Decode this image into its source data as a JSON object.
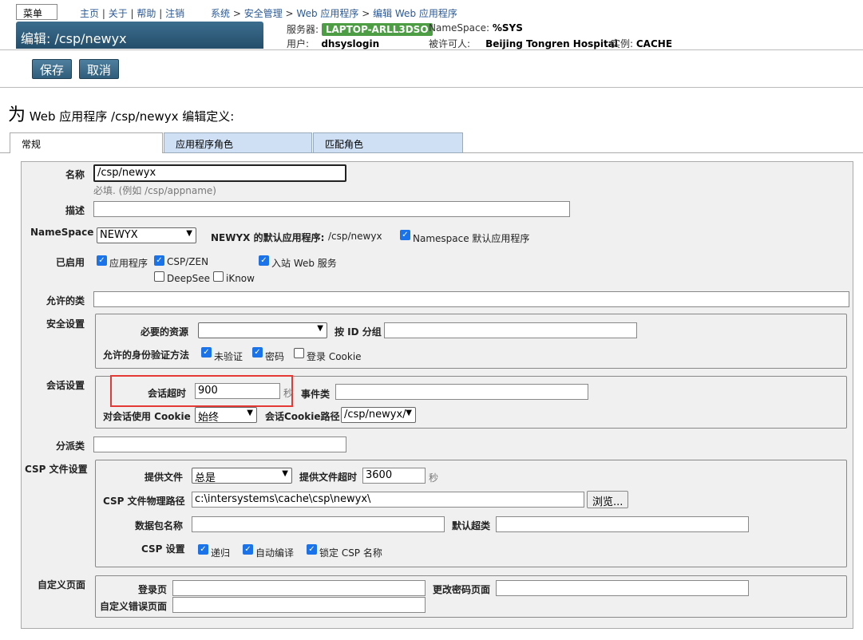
{
  "topbar": {
    "menu": "菜单",
    "links": [
      "主页",
      "关于",
      "帮助",
      "注销"
    ],
    "breadcrumb": [
      "系统",
      "安全管理",
      "Web 应用程序",
      "编辑 Web 应用程序"
    ],
    "title": "编辑: /csp/newyx",
    "server_label": "服务器:",
    "server": "LAPTOP-ARLL3DSO",
    "namespace_label": "NameSpace:",
    "namespace": "%SYS",
    "user_label": "用户:",
    "user": "dhsyslogin",
    "licensee_label": "被许可人:",
    "licensee": "Beijing Tongren Hospital",
    "instance_label": "实例:",
    "instance": "CACHE"
  },
  "toolbar": {
    "save": "保存",
    "cancel": "取消"
  },
  "heading": {
    "prefix": "为",
    "text": "Web 应用程序 /csp/newyx 编辑定义:"
  },
  "tabs": [
    "常规",
    "应用程序角色",
    "匹配角色"
  ],
  "form": {
    "name_label": "名称",
    "name_value": "/csp/newyx",
    "name_hint": "必填.  (例如 /csp/appname)",
    "desc_label": "描述",
    "desc_value": "",
    "ns_label": "NameSpace",
    "ns_value": "NEWYX",
    "default_app_label": "NEWYX 的默认应用程序:",
    "default_app_value": "/csp/newyx",
    "ns_default_label": "Namespace 默认应用程序",
    "enabled_label": "已启用",
    "enabled_app": "应用程序",
    "enabled_csp": "CSP/ZEN",
    "enabled_inbound": "入站 Web 服务",
    "enabled_deepsee": "DeepSee",
    "enabled_iknow": "iKnow",
    "allowed_class_label": "允许的类",
    "security_label": "安全设置",
    "required_resource_label": "必要的资源",
    "required_resource_value": "",
    "group_by_id_label": "按 ID 分组",
    "auth_label": "允许的身份验证方法",
    "auth_unauth": "未验证",
    "auth_password": "密码",
    "auth_cookie": "登录 Cookie",
    "session_label": "会话设置",
    "session_timeout_label": "会话超时",
    "session_timeout_value": "900",
    "seconds": "秒",
    "event_class_label": "事件类",
    "use_cookie_label": "对会话使用 Cookie",
    "use_cookie_value": "始终",
    "cookie_path_label": "会话Cookie路径",
    "cookie_path_value": "/csp/newyx/",
    "dispatch_label": "分派类",
    "csp_label": "CSP 文件设置",
    "serve_files_label": "提供文件",
    "serve_files_value": "总是",
    "serve_timeout_label": "提供文件超时",
    "serve_timeout_value": "3600",
    "csp_path_label": "CSP 文件物理路径",
    "csp_path_value": "c:\\intersystems\\cache\\csp\\newyx\\",
    "browse": "浏览...",
    "package_label": "数据包名称",
    "default_super_label": "默认超类",
    "csp_settings_label": "CSP 设置",
    "csp_recurse": "递归",
    "csp_autocompile": "自动编译",
    "csp_lock": "锁定 CSP 名称",
    "custom_pages_label": "自定义页面",
    "login_page_label": "登录页",
    "change_pw_label": "更改密码页面",
    "custom_error_label": "自定义错误页面"
  }
}
